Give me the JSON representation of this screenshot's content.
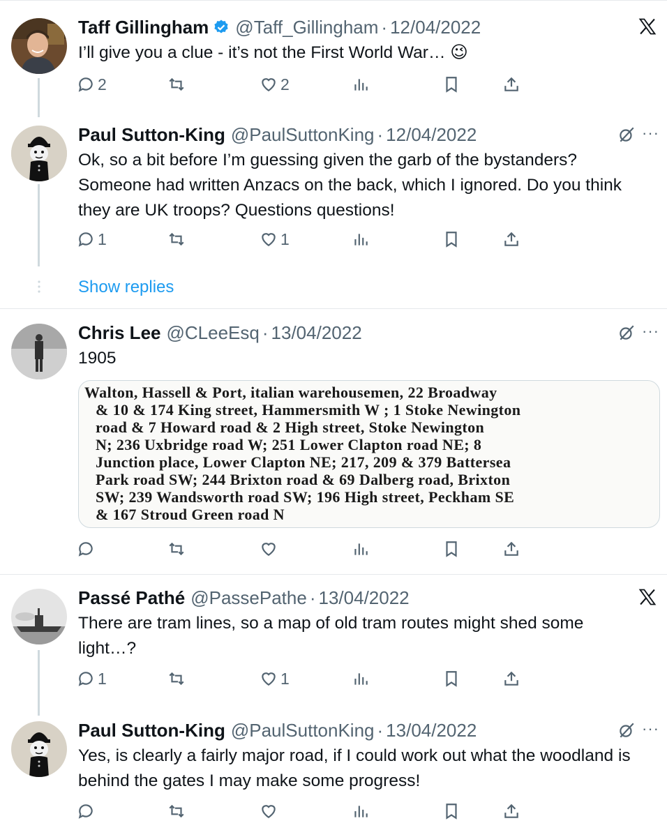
{
  "tweets": [
    {
      "name": "Taff Gillingham",
      "handle": "@Taff_Gillingham",
      "date": "12/04/2022",
      "text": "I’ll give you a clue - it’s not the First World War… 😉",
      "replies": "2",
      "reposts": "",
      "likes": "2",
      "verified": true,
      "top_icon": "x-logo-icon"
    },
    {
      "name": "Paul Sutton-King",
      "handle": "@PaulSuttonKing",
      "date": "12/04/2022",
      "text": "Ok, so a bit before I’m guessing given the garb of the bystanders? Someone had written Anzacs on the back, which I ignored. Do you think they are UK troops? Questions questions!",
      "replies": "1",
      "reposts": "",
      "likes": "1",
      "top_icon": "grok-icon"
    },
    {
      "name": "Chris Lee",
      "handle": "@CLeeEsq",
      "date": "13/04/2022",
      "text": "1905",
      "replies": "",
      "reposts": "",
      "likes": "",
      "top_icon": "grok-icon"
    },
    {
      "name": "Passé Pathé",
      "handle": "@PassePathe",
      "date": "13/04/2022",
      "text": "There are tram lines, so a map of old tram routes might shed some light…?",
      "replies": "1",
      "reposts": "",
      "likes": "1",
      "top_icon": "x-logo-icon"
    },
    {
      "name": "Paul Sutton-King",
      "handle": "@PaulSuttonKing",
      "date": "13/04/2022",
      "text": "Yes, is clearly a fairly major road, if I could work out what the woodland is behind the gates I may make some progress!",
      "replies": "",
      "reposts": "",
      "likes": "",
      "top_icon": "grok-icon"
    }
  ],
  "show_replies": "Show replies",
  "more_label": "···",
  "clipping_lines": [
    "Walton, Hassell & Port, italian warehousemen, 22 Broadway",
    "& 10 & 174 King street, Hammersmith W ; 1 Stoke Newington",
    "road & 7 Howard road & 2 High street, Stoke Newington",
    "N; 236 Uxbridge road W; 251 Lower Clapton road NE; 8",
    "Junction place, Lower Clapton NE; 217, 209 & 379 Battersea",
    "Park road SW; 244 Brixton road & 69 Dalberg road, Brixton",
    "SW; 239 Wandsworth road SW; 196 High street, Peckham SE",
    "& 167 Stroud Green road N"
  ],
  "colors": {
    "accent": "#1d9bf0",
    "secondary_text": "#536471",
    "divider": "#e6e9ec",
    "thread_line": "#cfd9de"
  }
}
